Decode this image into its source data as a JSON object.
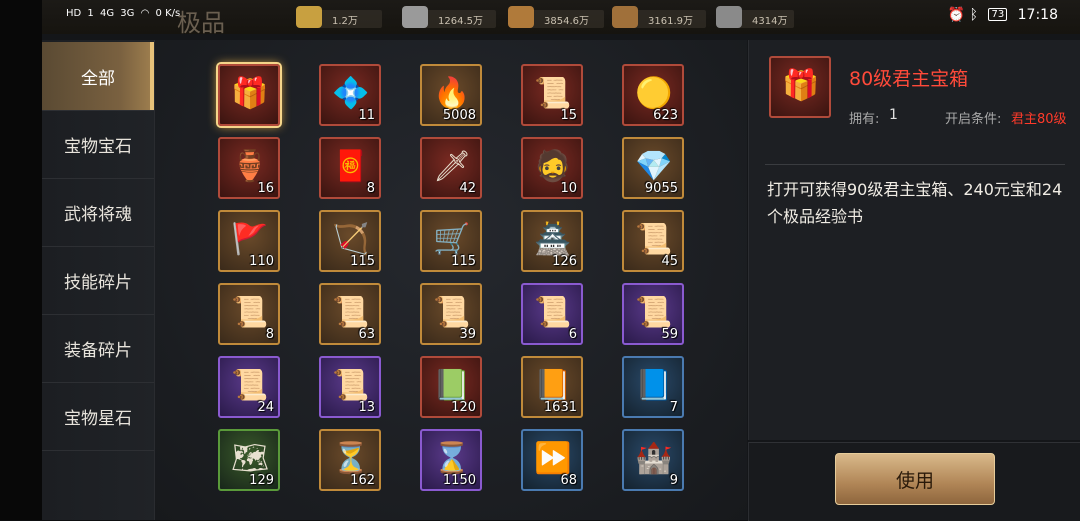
{
  "status_bar": {
    "network": [
      "HD",
      "1",
      "4G",
      "3G"
    ],
    "speed": "0 K/s",
    "title": "极品",
    "time": "17:18",
    "battery": "73"
  },
  "resources": [
    {
      "icon": "gold-ingot-icon",
      "value": "1.2万",
      "color": "#c8a040"
    },
    {
      "icon": "silver-coin-icon",
      "value": "1264.5万",
      "color": "#9a9a9a"
    },
    {
      "icon": "grain-sack-icon",
      "value": "3854.6万",
      "color": "#b07a3a"
    },
    {
      "icon": "wood-log-icon",
      "value": "3161.9万",
      "color": "#a0703a"
    },
    {
      "icon": "iron-ore-icon",
      "value": "4314万",
      "color": "#8a8a8a"
    }
  ],
  "sidebar": {
    "items": [
      {
        "label": "全部",
        "active": true
      },
      {
        "label": "宝物宝石",
        "active": false
      },
      {
        "label": "武将将魂",
        "active": false
      },
      {
        "label": "技能碎片",
        "active": false
      },
      {
        "label": "装备碎片",
        "active": false
      },
      {
        "label": "宝物星石",
        "active": false
      }
    ]
  },
  "items": [
    {
      "name": "lord-chest-80",
      "icon": "chest-icon",
      "glyph": "🎁",
      "quality": "red",
      "count": "",
      "selected": true
    },
    {
      "name": "red-gem-pack",
      "icon": "gem-pack-icon",
      "glyph": "💠",
      "quality": "red",
      "count": "11"
    },
    {
      "name": "fire-crystal",
      "icon": "fire-crystal-icon",
      "glyph": "🔥",
      "quality": "gold",
      "count": "5008"
    },
    {
      "name": "red-envelope-scroll",
      "icon": "scroll-icon",
      "glyph": "📜",
      "quality": "red",
      "count": "15"
    },
    {
      "name": "gold-jade",
      "icon": "jade-icon",
      "glyph": "🟡",
      "quality": "red",
      "count": "623"
    },
    {
      "name": "treasure-jar",
      "icon": "jar-icon",
      "glyph": "🏺",
      "quality": "red",
      "count": "16"
    },
    {
      "name": "red-gift-pack",
      "icon": "gift-pack-icon",
      "glyph": "🧧",
      "quality": "red",
      "count": "8"
    },
    {
      "name": "general-soul",
      "icon": "general-icon",
      "glyph": "🗡",
      "quality": "red",
      "count": "42"
    },
    {
      "name": "god-general-card",
      "icon": "warrior-icon",
      "glyph": "🧔",
      "quality": "red",
      "count": "10"
    },
    {
      "name": "rainbow-crystal",
      "icon": "crystal-icon",
      "glyph": "💎",
      "quality": "gold",
      "count": "9055"
    },
    {
      "name": "green-banner",
      "icon": "banner-icon",
      "glyph": "🚩",
      "quality": "gold",
      "count": "110"
    },
    {
      "name": "siege-ballista",
      "icon": "ballista-icon",
      "glyph": "🏹",
      "quality": "gold",
      "count": "115"
    },
    {
      "name": "siege-cart",
      "icon": "cart-icon",
      "glyph": "🛒",
      "quality": "gold",
      "count": "115"
    },
    {
      "name": "siege-tower",
      "icon": "tower-icon",
      "glyph": "🏯",
      "quality": "gold",
      "count": "126"
    },
    {
      "name": "skill-scroll-a",
      "icon": "scroll-icon",
      "glyph": "📜",
      "quality": "gold",
      "count": "45"
    },
    {
      "name": "skill-scroll-b",
      "icon": "scroll-icon",
      "glyph": "📜",
      "quality": "gold",
      "count": "8"
    },
    {
      "name": "skill-scroll-c",
      "icon": "scroll-icon",
      "glyph": "📜",
      "quality": "gold",
      "count": "63"
    },
    {
      "name": "skill-scroll-d",
      "icon": "scroll-icon",
      "glyph": "📜",
      "quality": "gold",
      "count": "39"
    },
    {
      "name": "skill-scroll-e",
      "icon": "scroll-icon",
      "glyph": "📜",
      "quality": "purple",
      "count": "6"
    },
    {
      "name": "skill-scroll-f",
      "icon": "scroll-icon",
      "glyph": "📜",
      "quality": "purple",
      "count": "59"
    },
    {
      "name": "skill-scroll-g",
      "icon": "scroll-icon",
      "glyph": "📜",
      "quality": "purple",
      "count": "24"
    },
    {
      "name": "skill-scroll-h",
      "icon": "scroll-icon",
      "glyph": "📜",
      "quality": "purple",
      "count": "13"
    },
    {
      "name": "green-bamboo-book",
      "icon": "book-icon",
      "glyph": "📗",
      "quality": "red",
      "count": "120"
    },
    {
      "name": "bronze-bamboo-book",
      "icon": "book-icon",
      "glyph": "📙",
      "quality": "gold",
      "count": "1631"
    },
    {
      "name": "blue-bamboo-scroll",
      "icon": "scroll-icon",
      "glyph": "📘",
      "quality": "blue",
      "count": "7"
    },
    {
      "name": "map-scroll",
      "icon": "map-icon",
      "glyph": "🗺",
      "quality": "green",
      "count": "129"
    },
    {
      "name": "gold-hourglass",
      "icon": "hourglass-icon",
      "glyph": "⏳",
      "quality": "gold",
      "count": "162"
    },
    {
      "name": "purple-hourglass",
      "icon": "hourglass-icon",
      "glyph": "⌛",
      "quality": "purple",
      "count": "1150"
    },
    {
      "name": "speedup-token",
      "icon": "fast-forward-icon",
      "glyph": "⏩",
      "quality": "blue",
      "count": "68"
    },
    {
      "name": "city-speedup",
      "icon": "castle-icon",
      "glyph": "🏰",
      "quality": "blue",
      "count": "9"
    }
  ],
  "detail": {
    "icon": "chest-icon",
    "glyph": "🎁",
    "name": "80级君主宝箱",
    "own_label": "拥有:",
    "own_value": "1",
    "condition_label": "开启条件:",
    "condition_value": "君主80级",
    "description": "打开可获得90级君主宝箱、240元宝和24个极品经验书",
    "use_button": "使用"
  }
}
